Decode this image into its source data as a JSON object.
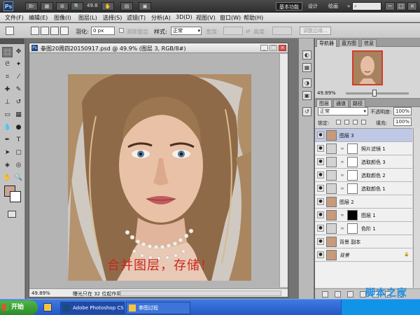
{
  "app": {
    "logo": "Ps",
    "zoom_value": "49.8",
    "workspace_active": "基本功能",
    "workspace_2": "设计",
    "workspace_3": "绘画",
    "more": "»",
    "win_min": "−",
    "win_max": "□",
    "win_close": "×"
  },
  "menu": [
    "文件(F)",
    "编辑(E)",
    "图像(I)",
    "图层(L)",
    "选择(S)",
    "滤镜(T)",
    "分析(A)",
    "3D(D)",
    "视图(V)",
    "窗口(W)",
    "帮助(H)"
  ],
  "options": {
    "feather_label": "羽化:",
    "feather_value": "0 px",
    "antialias_label": "消除锯齿",
    "style_label": "样式:",
    "style_value": "正常",
    "width_label": "宽度:",
    "height_label": "高度:",
    "refine_button": "调整边缘..."
  },
  "document": {
    "title": "拳图20周四20150917.psd @ 49.9% (图层 3, RGB/8#)",
    "overlay_text": "合并图层，存储！",
    "status_zoom": "49.89%",
    "status_text": "曝光只在 32 位起作用"
  },
  "navigator": {
    "tabs": [
      "导航器",
      "直方图",
      "信息"
    ],
    "zoom": "49.89%"
  },
  "layers": {
    "tabs": [
      "图层",
      "通道",
      "路径"
    ],
    "blend_mode": "正常",
    "opacity_label": "不透明度:",
    "opacity_value": "100%",
    "lock_label": "锁定:",
    "fill_label": "填充:",
    "fill_value": "100%",
    "items": [
      {
        "name": "图层 3",
        "thumb": "photo",
        "mask": "",
        "selected": true
      },
      {
        "name": "照片滤镜 1",
        "thumb": "adj",
        "mask": "white",
        "selected": false
      },
      {
        "name": "选取颜色 3",
        "thumb": "adj",
        "mask": "white",
        "selected": false
      },
      {
        "name": "选取颜色 2",
        "thumb": "adj",
        "mask": "white",
        "selected": false
      },
      {
        "name": "选取颜色 1",
        "thumb": "adj",
        "mask": "white",
        "selected": false
      },
      {
        "name": "图层 2",
        "thumb": "photo",
        "mask": "",
        "selected": false
      },
      {
        "name": "图层 1",
        "thumb": "photo",
        "mask": "dark",
        "selected": false
      },
      {
        "name": "色阶 1",
        "thumb": "adj",
        "mask": "white",
        "selected": false
      },
      {
        "name": "背景 副本",
        "thumb": "photo",
        "mask": "",
        "selected": false
      },
      {
        "name": "背景",
        "thumb": "photo",
        "mask": "",
        "selected": false
      }
    ],
    "fx": "fx"
  },
  "taskbar": {
    "start": "开始",
    "task1": "Adobe Photoshop CS5",
    "task2": "拳图过程"
  },
  "watermark": {
    "site": "jb51.net",
    "brand": "脚本之家"
  },
  "colors": {
    "foreground": "#c8a493",
    "background": "#ffffff",
    "overlay_text": "#c9271c",
    "selected_layer": "#bfc8e4"
  }
}
